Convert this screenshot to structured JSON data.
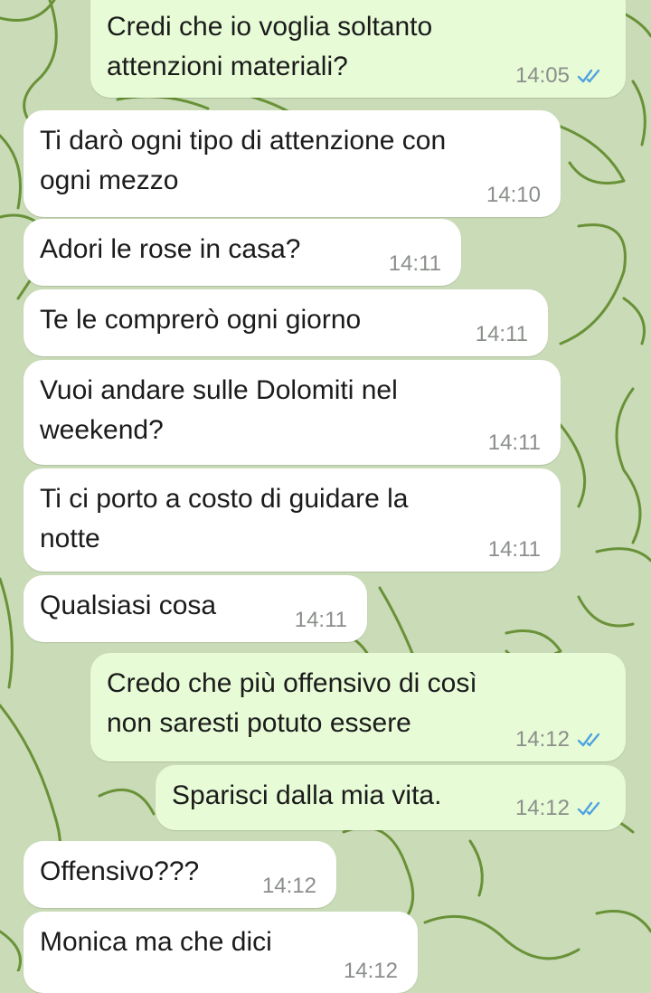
{
  "chat": {
    "messages": [
      {
        "direction": "out",
        "text": "Credi che io voglia soltanto\nattenzioni materiali?",
        "time": "14:05",
        "read": true
      },
      {
        "direction": "in",
        "text": "Ti darò ogni tipo di attenzione con\nogni mezzo",
        "time": "14:10"
      },
      {
        "direction": "in",
        "text": "Adori le rose in casa?",
        "time": "14:11"
      },
      {
        "direction": "in",
        "text": "Te le comprerò ogni giorno",
        "time": "14:11"
      },
      {
        "direction": "in",
        "text": "Vuoi andare sulle Dolomiti nel\nweekend?",
        "time": "14:11"
      },
      {
        "direction": "in",
        "text": "Ti ci porto a costo di guidare la\nnotte",
        "time": "14:11"
      },
      {
        "direction": "in",
        "text": "Qualsiasi cosa",
        "time": "14:11"
      },
      {
        "direction": "out",
        "text": "Credo che più offensivo di così\nnon saresti potuto essere",
        "time": "14:12",
        "read": true
      },
      {
        "direction": "out",
        "text": "Sparisci dalla mia vita.",
        "time": "14:12",
        "read": true
      },
      {
        "direction": "in",
        "text": "Offensivo???",
        "time": "14:12"
      },
      {
        "direction": "in",
        "text": "Monica ma che dici",
        "time": "14:12"
      }
    ]
  },
  "colors": {
    "wallpaper": "#c9dbb7",
    "doodle": "#5f8a2a",
    "incoming_bubble": "#ffffff",
    "outgoing_bubble": "#e7fbd6",
    "read_tick": "#4fa3e0",
    "time_text": "#8a8f8a"
  },
  "icons": {
    "read_receipt": "double-check-icon"
  }
}
